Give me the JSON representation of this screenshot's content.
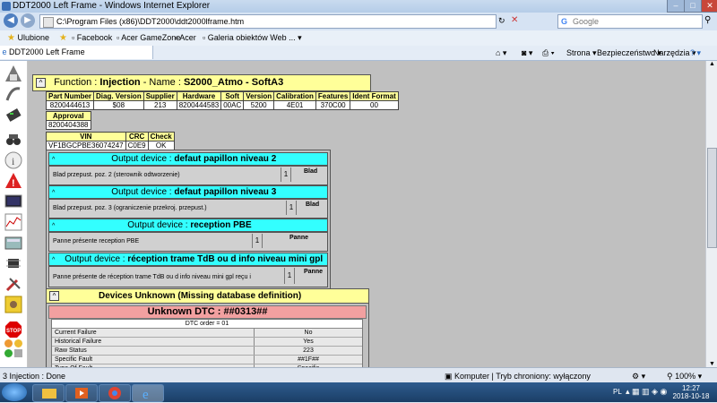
{
  "window": {
    "title": "DDT2000 Left Frame - Windows Internet Explorer",
    "min": "–",
    "max": "□",
    "close": "✕"
  },
  "address": {
    "url": "C:\\Program Files (x86)\\DDT2000\\ddt2000lframe.htm",
    "search_placeholder": "Google"
  },
  "favorites": {
    "ulubione": "Ulubione",
    "items": [
      "Facebook",
      "Acer GameZone",
      "Acer",
      "Galeria obiektów Web ..."
    ]
  },
  "tab": {
    "label": "DDT2000 Left Frame"
  },
  "commands": [
    "Strona ▾",
    "Bezpieczeństwo ▾",
    "Narzędzia ▾"
  ],
  "function_header": {
    "function_label": "Function : ",
    "function_value": "Injection",
    "name_label": " - Name : ",
    "name_value": "S2000_Atmo - SoftA3"
  },
  "ident": {
    "headers": [
      "Part Number",
      "Diag. Version",
      "Supplier",
      "Hardware",
      "Soft",
      "Version",
      "Calibration",
      "Features",
      "Ident Format"
    ],
    "values": [
      "8200444613",
      "$08",
      "213",
      "8200444583",
      "00AC",
      "5200",
      "4E01",
      "370C00",
      "00"
    ]
  },
  "approval": {
    "header": "Approval",
    "value": "8200404388"
  },
  "vin": {
    "headers": [
      "VIN",
      "CRC",
      "Check"
    ],
    "values": [
      "VF1BGCPBE36074247",
      "C0E9",
      "OK"
    ]
  },
  "output_devices": [
    {
      "label": "Output device : ",
      "name": "defaut papillon niveau 2",
      "desc": "Blad przepust. poz. 2 (sterownik odtworzenie)",
      "num": "1",
      "state": "Blad"
    },
    {
      "label": "Output device : ",
      "name": "defaut papillon niveau 3",
      "desc": "Blad przepust. poz. 3 (ograniczenie przekroj. przepust.)",
      "num": "1",
      "state": "Blad"
    },
    {
      "label": "Output device : ",
      "name": "reception PBE",
      "desc": "Panne présente reception PBE",
      "num": "1",
      "state": "Panne"
    },
    {
      "label": "Output device : ",
      "name": "réception trame TdB ou d info niveau mini gpl reçu i",
      "desc": "Panne présente de réception trame TdB ou d info niveau mini gpl reçu i",
      "num": "1",
      "state": "Panne"
    }
  ],
  "unknown": {
    "title": "Devices Unknown (Missing database definition)",
    "dtc_title": "Unknown DTC : ##0313##",
    "dtc_order": "DTC order = 01",
    "rows": [
      {
        "k": "Current Failure",
        "v": "No"
      },
      {
        "k": "Historical Failure",
        "v": "Yes"
      },
      {
        "k": "Raw Status",
        "v": "223"
      },
      {
        "k": "Specific Fault",
        "v": "##1F##"
      },
      {
        "k": "Type Of Fault",
        "v": "Specific"
      }
    ]
  },
  "status": {
    "left": "3 Injection : Done",
    "zone": "Komputer | Tryb chroniony: wyłączony",
    "zoom": "100%"
  },
  "taskbar": {
    "lang": "PL",
    "time": "12:27",
    "date": "2018-10-18"
  },
  "colors": {
    "cyan": "#33ffff",
    "yellow": "#ffff99",
    "pink": "#f2a0a0",
    "gray": "#c0c0c0"
  }
}
